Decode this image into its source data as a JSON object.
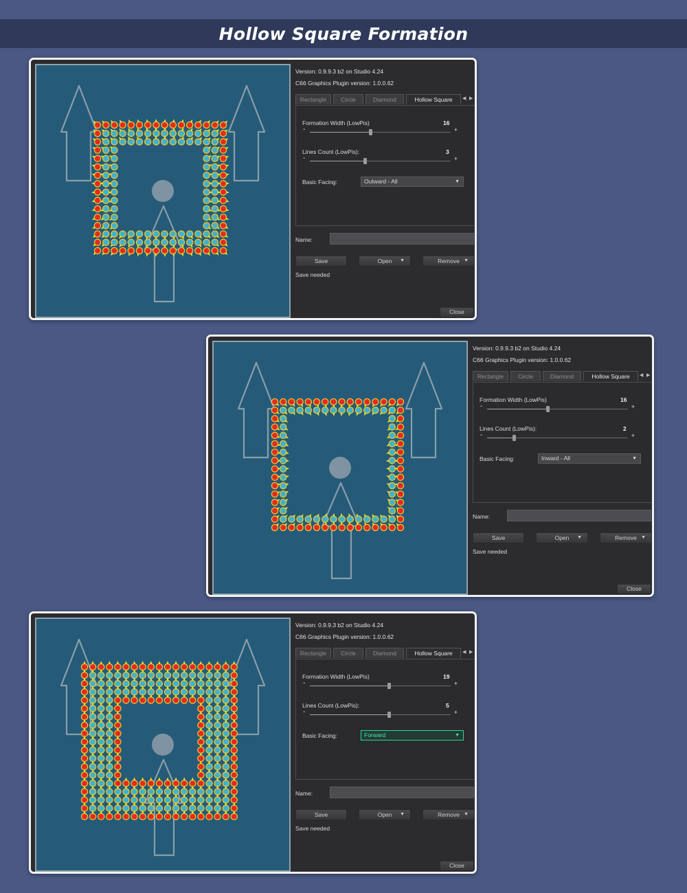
{
  "banner": {
    "title": "Hollow Square Formation"
  },
  "panels": [
    {
      "version": "Version: 0.9.9.3 b2 on Studio 4.24",
      "plugin_version": "C66 Graphics Plugin version: 1.0.0.62",
      "tabs": [
        "Rectangle",
        "Circle",
        "Diamond",
        "Hollow Square"
      ],
      "active_tab": "Hollow Square",
      "formation_width_label": "Formation Width (LowPis)",
      "formation_width_value": 16,
      "formation_width_fraction": 0.42,
      "lines_count_label": "Lines Count (LowPis):",
      "lines_count_value": 3,
      "lines_count_fraction": 0.38,
      "basic_facing_label": "Basic Facing:",
      "basic_facing_value": "Outward - All",
      "name_label": "Name:",
      "name_value": "",
      "save_label": "Save",
      "open_label": "Open",
      "remove_label": "Remove",
      "status": "Save needed",
      "close_label": "Close",
      "formation": {
        "grid": 16,
        "lines": 3,
        "facing": "outward"
      }
    },
    {
      "version": "Version: 0.9.9.3 b2 on Studio 4.24",
      "plugin_version": "C66 Graphics Plugin version: 1.0.0.62",
      "tabs": [
        "Rectangle",
        "Circle",
        "Diamond",
        "Hollow Square"
      ],
      "active_tab": "Hollow Square",
      "formation_width_label": "Formation Width (LowPis)",
      "formation_width_value": 16,
      "formation_width_fraction": 0.42,
      "lines_count_label": "Lines Count (LowPis):",
      "lines_count_value": 2,
      "lines_count_fraction": 0.18,
      "basic_facing_label": "Basic Facing:",
      "basic_facing_value": "Inward - All",
      "name_label": "Name:",
      "name_value": "",
      "save_label": "Save",
      "open_label": "Open",
      "remove_label": "Remove",
      "status": "Save needed",
      "close_label": "Close",
      "formation": {
        "grid": 16,
        "lines": 2,
        "facing": "inward"
      }
    },
    {
      "version": "Version: 0.9.9.3 b2 on Studio 4.24",
      "plugin_version": "C66 Graphics Plugin version: 1.0.0.62",
      "tabs": [
        "Rectangle",
        "Circle",
        "Diamond",
        "Hollow Square"
      ],
      "active_tab": "Hollow Square",
      "formation_width_label": "Formation Width (LowPis)",
      "formation_width_value": 19,
      "formation_width_fraction": 0.55,
      "lines_count_label": "Lines Count (LowPis):",
      "lines_count_value": 5,
      "lines_count_fraction": 0.55,
      "basic_facing_label": "Basic Facing:",
      "basic_facing_value": "Forward",
      "name_label": "Name:",
      "name_value": "",
      "save_label": "Save",
      "open_label": "Open",
      "remove_label": "Remove",
      "status": "Save needed",
      "close_label": "Close",
      "formation": {
        "grid": 19,
        "lines": 5,
        "facing": "forward"
      }
    }
  ],
  "colors": {
    "unit_core": "#e32b1f",
    "unit_ring": "#f2c230",
    "inner_unit": "#3fb3cc",
    "facing_arrow": "#e8f020",
    "field": "#255b78"
  }
}
